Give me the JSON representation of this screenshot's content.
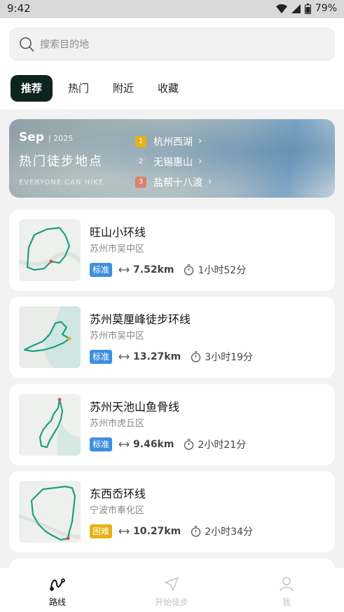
{
  "status_bar": {
    "time": "9:42",
    "battery": "79%"
  },
  "search": {
    "placeholder": "搜索目的地"
  },
  "tabs": [
    {
      "label": "推荐",
      "active": true
    },
    {
      "label": "热门",
      "active": false
    },
    {
      "label": "附近",
      "active": false
    },
    {
      "label": "收藏",
      "active": false
    }
  ],
  "banner": {
    "month": "Sep",
    "year": "| 2025",
    "title": "热门徒步地点",
    "subtitle": "EVERYONE CAN HIKE",
    "ranking": [
      {
        "rank": "1",
        "name": "杭州西湖",
        "color": "#e8b20f"
      },
      {
        "rank": "2",
        "name": "无锡惠山",
        "color": "#a7b3c2"
      },
      {
        "rank": "3",
        "name": "盐帮十八渡",
        "color": "#d9826a"
      }
    ]
  },
  "routes": [
    {
      "name": "旺山小环线",
      "location": "苏州市吴中区",
      "difficulty": "标准",
      "difficulty_color": "#3d8fe0",
      "distance": "7.52km",
      "duration": "1小时52分"
    },
    {
      "name": "苏州莫厘峰徒步环线",
      "location": "苏州市吴中区",
      "difficulty": "标准",
      "difficulty_color": "#3d8fe0",
      "distance": "13.27km",
      "duration": "3小时19分"
    },
    {
      "name": "苏州天池山鱼骨线",
      "location": "苏州市虎丘区",
      "difficulty": "标准",
      "difficulty_color": "#3d8fe0",
      "distance": "9.46km",
      "duration": "2小时21分"
    },
    {
      "name": "东西岙环线",
      "location": "宁波市奉化区",
      "difficulty": "困难",
      "difficulty_color": "#e8b20f",
      "distance": "10.27km",
      "duration": "2小时34分"
    }
  ],
  "bottom_nav": [
    {
      "label": "路线",
      "icon": "route-icon",
      "active": true
    },
    {
      "label": "开始徒步",
      "icon": "navigate-icon",
      "active": false
    },
    {
      "label": "我",
      "icon": "user-icon",
      "active": false
    }
  ],
  "colors": {
    "accent_dark": "#0f241f",
    "route_line": "#1aa083"
  }
}
